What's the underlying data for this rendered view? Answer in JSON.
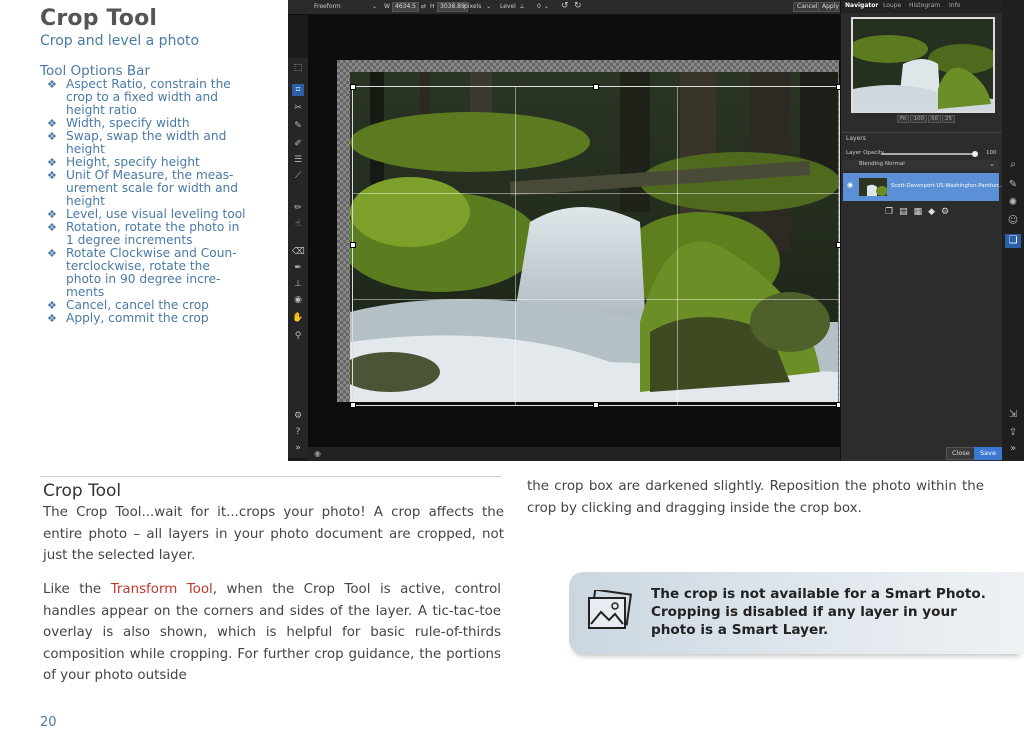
{
  "header": {
    "title": "Crop Tool",
    "subtitle": "Crop and level a photo"
  },
  "tool_options": {
    "heading": "Tool Options Bar",
    "bullet": "❖",
    "items": [
      "Aspect Ratio, constrain the crop to a fixed width and height ratio",
      "Width, specify width",
      "Swap, swap the width and height",
      "Height, specify height",
      "Unit Of Measure, the measurement scale for width and height",
      "Level, use visual leveling tool",
      "Rotation, rotate the photo in 1 degree increments",
      "Rotate Clockwise and Counterclockwise, rotate the photo in 90 degree increments",
      "Cancel, cancel the crop",
      "Apply, commit the crop"
    ],
    "items_display": [
      [
        "Aspect Ratio, constrain the",
        "crop to a fixed width and",
        "height ratio"
      ],
      [
        "Width, specify width"
      ],
      [
        "Swap, swap the width and",
        "height"
      ],
      [
        "Height, specify height"
      ],
      [
        "Unit Of Measure, the meas-",
        "urement scale for width and",
        "height"
      ],
      [
        "Level, use visual leveling tool"
      ],
      [
        "Rotation, rotate the photo in",
        "1 degree increments"
      ],
      [
        "Rotate Clockwise and Coun-",
        "terclockwise, rotate the",
        "photo in 90 degree incre-",
        "ments"
      ],
      [
        "Cancel, cancel the crop"
      ],
      [
        "Apply, commit the crop"
      ]
    ]
  },
  "app": {
    "options_bar": {
      "aspect": "Freeform",
      "w_label": "W",
      "w_value": "4634.5",
      "h_label": "H",
      "h_value": "3038.89",
      "unit": "pixels",
      "level_label": "Level",
      "rotation": "0",
      "cancel": "Cancel",
      "apply": "Apply"
    },
    "panel_tabs": [
      "Navigator",
      "Loupe",
      "Histogram",
      "Info"
    ],
    "zoom_buttons": [
      "Fit",
      "100",
      "50",
      "25"
    ],
    "layers": {
      "title": "Layers",
      "opacity_label": "Layer Opacity",
      "opacity_value": "100",
      "blending": "Blending Normal",
      "layer_name": "Scott-Davenport-US-Washington-Panther..."
    },
    "footer": {
      "close": "Close",
      "save": "Save"
    },
    "colors": {
      "accent": "#2b5fa8",
      "layer_selected": "#5b8fd6"
    }
  },
  "body": {
    "section_title": "Crop Tool",
    "para1": "The Crop Tool...wait for it...crops your photo! A crop affects the entire photo – all layers in your photo document are cropped, not just the selected layer.",
    "para2_pre": "Like the ",
    "para2_link": "Transform Tool",
    "para2_post": ", when the Crop Tool is active, control handles appear on the corners and sides of the layer. A tic-tac-toe overlay is also shown, which is helpful for basic rule-of-thirds composition while cropping. For further crop guidance, the portions of your photo outside",
    "para3": "the crop box are darkened slightly. Reposition the photo within the crop by clicking and dragging inside the crop box.",
    "note": "The crop is not available for a Smart Photo. Cropping is disabled if any layer in your photo is a Smart Layer.",
    "note_icon": "photo-icon"
  },
  "page_number": "20"
}
